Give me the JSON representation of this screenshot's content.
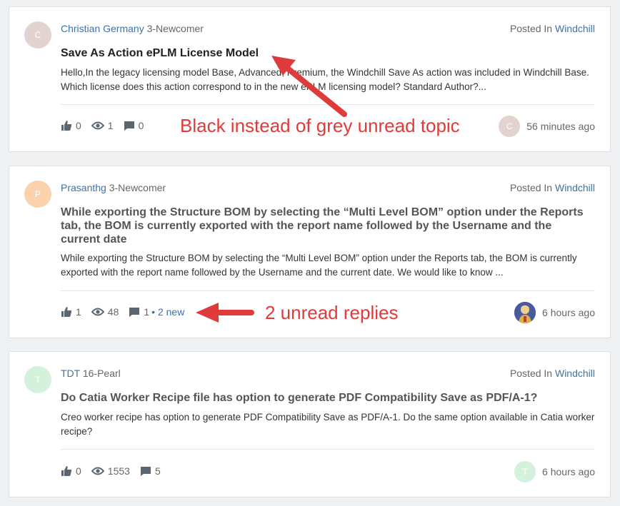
{
  "posts": [
    {
      "author": "Christian Germany",
      "rank": "3-Newcomer",
      "avatar_letter": "C",
      "avatar_color": "#e2d2d0",
      "posted_in_prefix": "Posted In",
      "board": "Windchill",
      "title": "Save As Action ePLM License Model",
      "title_state": "unread",
      "excerpt": "Hello,In the legacy licensing model Base, Advanced, Premium, the Windchill Save As action was included in Windchill Base. Which license does this action correspond to in the new ePLM licensing model? Standard Author?...",
      "kudos": "0",
      "views": "1",
      "replies": "0",
      "new_replies": "",
      "last_avatar_letter": "C",
      "last_avatar_color": "#e2d2d0",
      "last_activity": "56 minutes ago"
    },
    {
      "author": "Prasanthg",
      "rank": "3-Newcomer",
      "avatar_letter": "P",
      "avatar_color": "#fcd2ad",
      "posted_in_prefix": "Posted In",
      "board": "Windchill",
      "title": "While exporting the Structure BOM by selecting the “Multi Level BOM” option under the Reports tab, the BOM is currently exported with the report name followed by the Username and the current date",
      "title_state": "read",
      "excerpt": "While exporting the Structure BOM by selecting the “Multi Level BOM” option under the Reports tab, the BOM is currently exported with the report name followed by the Username and the current date. We would like to know ...",
      "kudos": "1",
      "views": "48",
      "replies": "1",
      "new_replies": "• 2 new",
      "last_activity": "6 hours ago"
    },
    {
      "author": "TDT",
      "rank": "16-Pearl",
      "avatar_letter": "T",
      "avatar_color": "#d4f1dc",
      "posted_in_prefix": "Posted In",
      "board": "Windchill",
      "title": "Do Catia Worker Recipe file has option to generate PDF Compatibility Save as PDF/A-1?",
      "title_state": "read",
      "excerpt": "Creo worker recipe has option to generate PDF Compatibility Save as PDF/A-1. Do the same option available in Catia worker recipe?",
      "kudos": "0",
      "views": "1553",
      "replies": "5",
      "new_replies": "",
      "last_avatar_letter": "T",
      "last_avatar_color": "#d4f1dc",
      "last_activity": "6 hours ago"
    }
  ],
  "annotations": {
    "first": "Black instead of grey unread topic",
    "second": "2 unread replies",
    "color": "#e03b3b"
  },
  "icons": {
    "kudos": "thumbs-up-icon",
    "views": "eye-icon",
    "replies": "speech-bubble-icon"
  }
}
